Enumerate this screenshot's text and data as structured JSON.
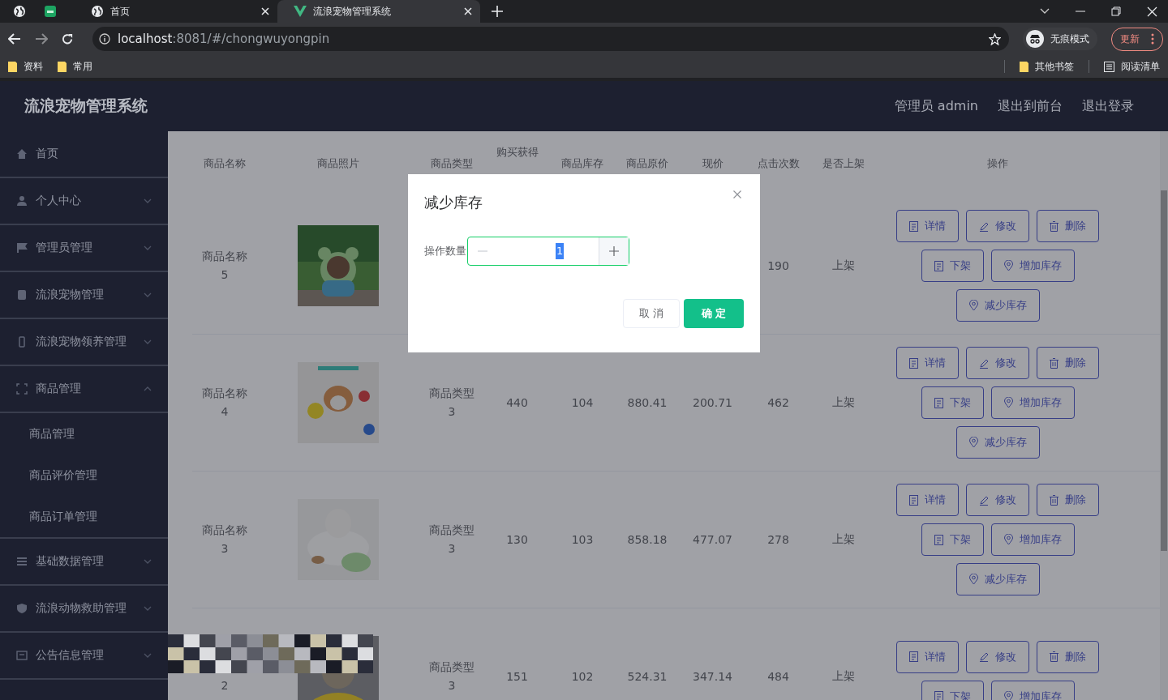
{
  "browser": {
    "tabs": [
      {
        "title": "首页",
        "selected": false
      },
      {
        "title": "流浪宠物管理系统",
        "selected": true
      }
    ],
    "url": {
      "host": "localhost",
      "rest": ":8081/#/chongwuyongpin"
    },
    "profile": "无痕模式",
    "update": "更新",
    "bookmarks": [
      "资料",
      "常用"
    ],
    "bookmarks_right": [
      {
        "label": "其他书签",
        "kind": "folder"
      },
      {
        "label": "阅读清单",
        "kind": "list"
      }
    ]
  },
  "app": {
    "title": "流浪宠物管理系统",
    "header_links": [
      "管理员 admin",
      "退出到前台",
      "退出登录"
    ],
    "sidebar": [
      {
        "label": "首页"
      },
      {
        "label": "个人中心",
        "expanded": false
      },
      {
        "label": "管理员管理",
        "expanded": false
      },
      {
        "label": "流浪宠物管理",
        "expanded": false
      },
      {
        "label": "流浪宠物领养管理",
        "expanded": false
      },
      {
        "label": "商品管理",
        "expanded": true,
        "children": [
          "商品管理",
          "商品评价管理",
          "商品订单管理"
        ]
      },
      {
        "label": "基础数据管理",
        "expanded": false
      },
      {
        "label": "流浪动物救助管理",
        "expanded": false
      },
      {
        "label": "公告信息管理",
        "expanded": false
      }
    ],
    "table": {
      "columns": [
        "商品名称",
        "商品照片",
        "商品类型",
        "购买获得",
        "商品库存",
        "商品原价",
        "现价",
        "点击次数",
        "是否上架",
        "操作"
      ],
      "rows": [
        {
          "name": "商品名称5",
          "photo": {
            "kind": "picture"
          },
          "clicks": "190",
          "status": "上架",
          "actions": [
            {
              "label": "详情",
              "kind": "detail"
            },
            {
              "label": "修改",
              "kind": "edit"
            },
            {
              "label": "删除",
              "kind": "delete"
            },
            {
              "label": "下架",
              "kind": "off_shelf"
            },
            {
              "label": "增加库存",
              "kind": "add_stock"
            },
            {
              "label": "减少库存",
              "kind": "reduce_stock"
            }
          ]
        },
        {
          "name": "商品名称4",
          "photo": {
            "kind": "picture"
          },
          "type": "商品类型3",
          "points": "440",
          "stock": "104",
          "original_price": "880.41",
          "price": "200.71",
          "clicks": "462",
          "status": "上架",
          "actions": [
            {
              "label": "详情",
              "kind": "detail"
            },
            {
              "label": "修改",
              "kind": "edit"
            },
            {
              "label": "删除",
              "kind": "delete"
            },
            {
              "label": "下架",
              "kind": "off_shelf"
            },
            {
              "label": "增加库存",
              "kind": "add_stock"
            },
            {
              "label": "减少库存",
              "kind": "reduce_stock"
            }
          ]
        },
        {
          "name": "商品名称3",
          "photo": {
            "kind": "picture"
          },
          "type": "商品类型3",
          "points": "130",
          "stock": "103",
          "original_price": "858.18",
          "price": "477.07",
          "clicks": "278",
          "status": "上架",
          "actions": [
            {
              "label": "详情",
              "kind": "detail"
            },
            {
              "label": "修改",
              "kind": "edit"
            },
            {
              "label": "删除",
              "kind": "delete"
            },
            {
              "label": "下架",
              "kind": "off_shelf"
            },
            {
              "label": "增加库存",
              "kind": "add_stock"
            },
            {
              "label": "减少库存",
              "kind": "reduce_stock"
            }
          ]
        },
        {
          "name": "2",
          "photo": {
            "kind": "picture"
          },
          "type": "商品类型3",
          "points": "151",
          "stock": "102",
          "original_price": "524.31",
          "price": "347.14",
          "clicks": "484",
          "status": "上架",
          "actions": [
            {
              "label": "详情",
              "kind": "detail"
            },
            {
              "label": "修改",
              "kind": "edit"
            },
            {
              "label": "删除",
              "kind": "delete"
            },
            {
              "label": "下架",
              "kind": "off_shelf"
            },
            {
              "label": "增加库存",
              "kind": "add_stock"
            }
          ]
        }
      ]
    },
    "dialog": {
      "title": "减少库存",
      "field_label": "操作数量",
      "value": "1",
      "cancel": "取 消",
      "confirm": "确 定"
    }
  }
}
